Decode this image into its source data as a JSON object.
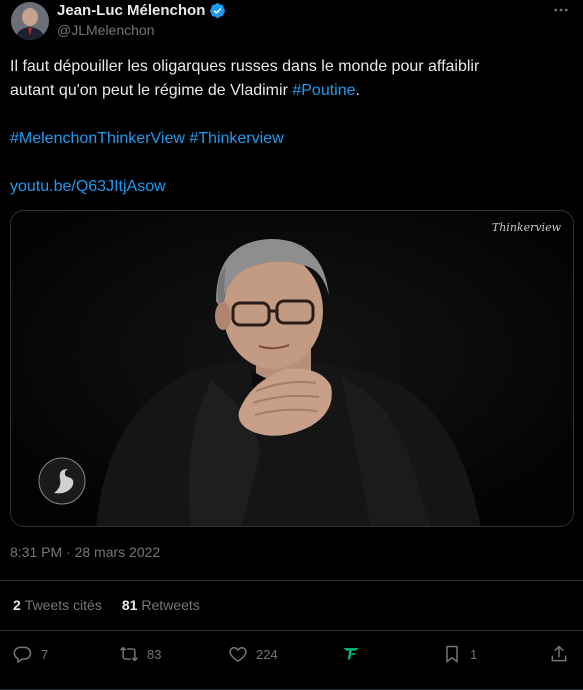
{
  "author": {
    "display_name": "Jean-Luc Mélenchon",
    "handle": "@JLMelenchon",
    "verified": true
  },
  "tweet": {
    "line1": "Il faut dépouiller les oligarques russes dans le monde pour affaiblir",
    "line2_prefix": "autant qu'on peut le régime de Vladimir ",
    "line2_hashtag": "#Poutine",
    "line2_suffix": ".",
    "hashtag1": "#MelenchonThinkerView",
    "hashtag2": "#Thinkerview",
    "link": "youtu.be/Q63JItjAsow"
  },
  "media": {
    "watermark": "Thinkerview"
  },
  "timestamp": "8:31 PM · 28 mars 2022",
  "stats": {
    "quotes_count": "2",
    "quotes_label": "Tweets cités",
    "retweets_count": "81",
    "retweets_label": "Retweets"
  },
  "actions": {
    "reply_count": "7",
    "retweet_count": "83",
    "like_count": "224",
    "bookmark_count": "1"
  },
  "colors": {
    "background": "#000000",
    "text": "#e7e9ea",
    "muted": "#71767b",
    "link": "#1d9bf0",
    "border": "#2f3336",
    "app_icon": "#00ba7c"
  }
}
